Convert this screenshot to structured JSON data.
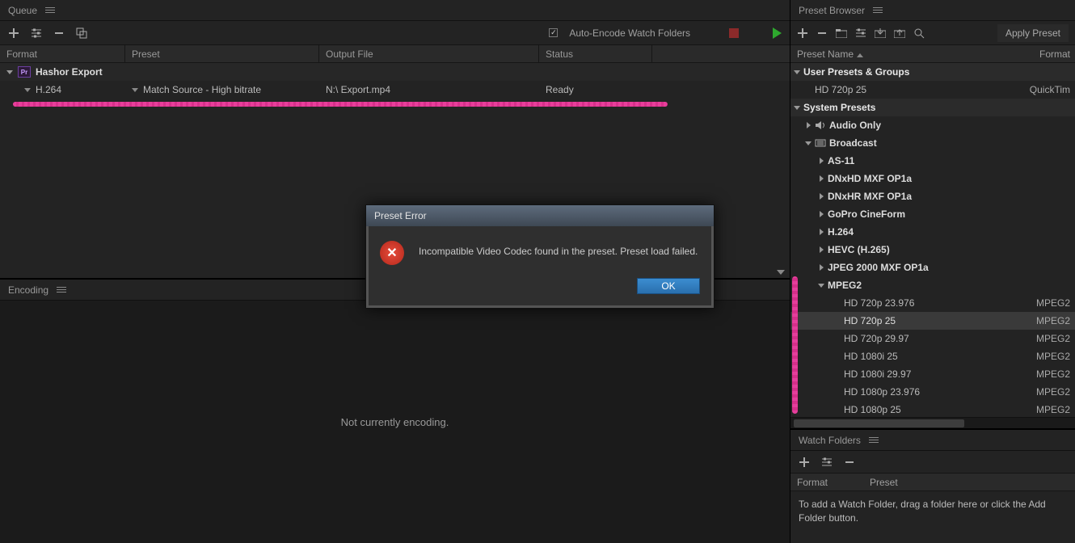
{
  "queue": {
    "title": "Queue",
    "auto_encode_label": "Auto-Encode Watch Folders",
    "columns": {
      "format": "Format",
      "preset": "Preset",
      "outfile": "Output File",
      "status": "Status"
    },
    "group_name": "Hashor Export",
    "job": {
      "format": "H.264",
      "preset": "Match Source - High bitrate",
      "outfile": "N:\\  Export.mp4",
      "status": "Ready"
    }
  },
  "encoding": {
    "title": "Encoding",
    "message": "Not currently encoding."
  },
  "preset_browser": {
    "title": "Preset Browser",
    "apply_label": "Apply Preset",
    "col_name": "Preset Name",
    "col_format": "Format",
    "user_section": "User Presets & Groups",
    "user_preset": {
      "name": "HD 720p 25",
      "format": "QuickTim"
    },
    "system_section": "System Presets",
    "audio_only": "Audio Only",
    "broadcast": "Broadcast",
    "broadcast_children": [
      "AS-11",
      "DNxHD MXF OP1a",
      "DNxHR MXF OP1a",
      "GoPro CineForm",
      "H.264",
      "HEVC (H.265)",
      "JPEG 2000 MXF OP1a"
    ],
    "mpeg2": "MPEG2",
    "mpeg2_presets": [
      {
        "name": "HD 720p 23.976",
        "format": "MPEG2"
      },
      {
        "name": "HD 720p 25",
        "format": "MPEG2",
        "selected": true
      },
      {
        "name": "HD 720p 29.97",
        "format": "MPEG2"
      },
      {
        "name": "HD 1080i 25",
        "format": "MPEG2"
      },
      {
        "name": "HD 1080i 29.97",
        "format": "MPEG2"
      },
      {
        "name": "HD 1080p 23.976",
        "format": "MPEG2"
      },
      {
        "name": "HD 1080p 25",
        "format": "MPEG2"
      }
    ]
  },
  "watch_folders": {
    "title": "Watch Folders",
    "col_format": "Format",
    "col_preset": "Preset",
    "instruction": "To add a Watch Folder, drag a folder here or click the Add Folder button."
  },
  "dialog": {
    "title": "Preset Error",
    "message": "Incompatible Video Codec found in the preset. Preset load failed.",
    "ok": "OK"
  }
}
